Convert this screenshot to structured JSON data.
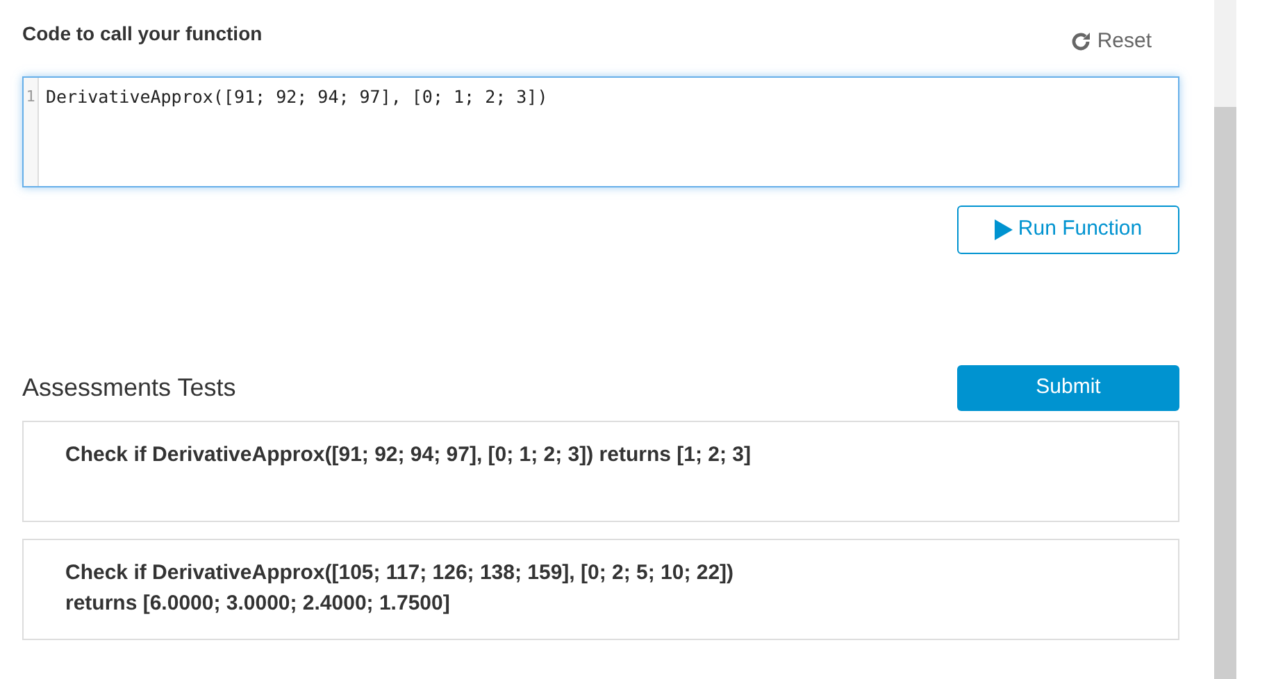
{
  "code_section": {
    "title": "Code to call your function",
    "reset_label": "Reset",
    "editor": {
      "lines": [
        {
          "number": "1",
          "text": "DerivativeApprox([91; 92; 94; 97], [0; 1; 2; 3])"
        }
      ]
    },
    "run_button": "Run Function"
  },
  "assessments": {
    "title": "Assessments Tests",
    "submit_button": "Submit",
    "tests": [
      {
        "text": "Check if DerivativeApprox([91; 92; 94; 97], [0; 1; 2; 3]) returns [1; 2; 3]"
      },
      {
        "text": "Check if DerivativeApprox([105; 117; 126; 138; 159], [0; 2; 5; 10; 22]) returns [6.0000; 3.0000; 2.4000; 1.7500]"
      }
    ]
  }
}
